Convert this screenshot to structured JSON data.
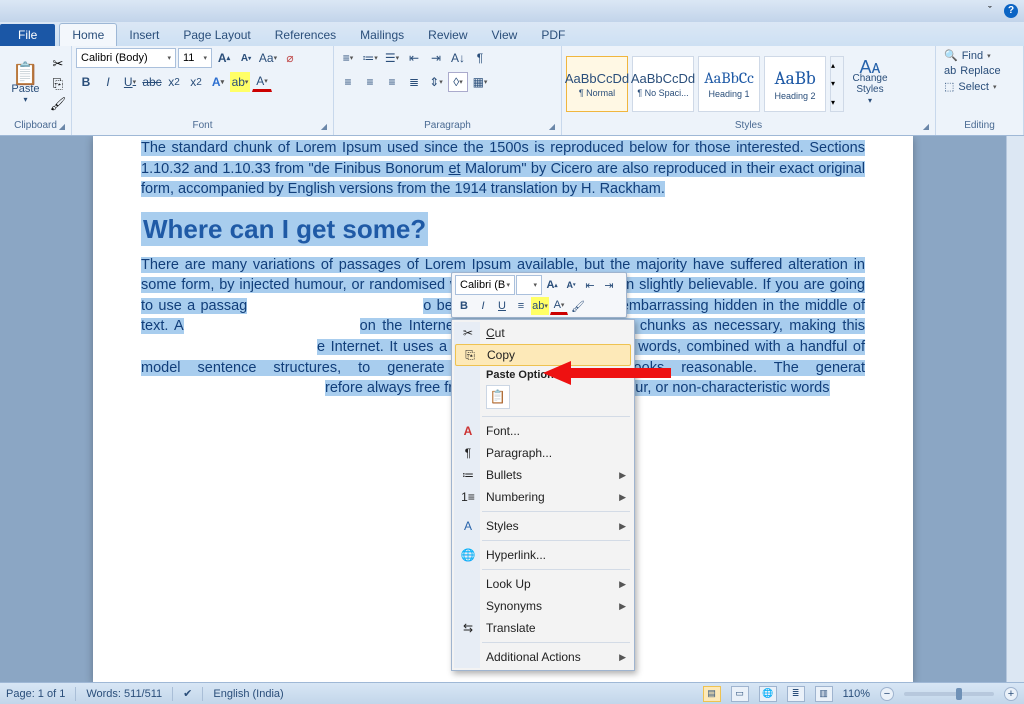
{
  "tabs": {
    "file": "File",
    "home": "Home",
    "insert": "Insert",
    "pageLayout": "Page Layout",
    "references": "References",
    "mailings": "Mailings",
    "review": "Review",
    "view": "View",
    "pdf": "PDF"
  },
  "clipboard": {
    "paste": "Paste",
    "label": "Clipboard"
  },
  "font": {
    "name": "Calibri (Body)",
    "size": "11",
    "label": "Font"
  },
  "paragraph": {
    "label": "Paragraph"
  },
  "styles": {
    "label": "Styles",
    "items": [
      {
        "sample": "AaBbCcDd",
        "name": "¶ Normal"
      },
      {
        "sample": "AaBbCcDd",
        "name": "¶ No Spaci..."
      },
      {
        "sample": "AaBbCc",
        "name": "Heading 1"
      },
      {
        "sample": "AaBb",
        "name": "Heading 2"
      }
    ],
    "change": "Change Styles"
  },
  "editing": {
    "find": "Find",
    "replace": "Replace",
    "select": "Select",
    "label": "Editing"
  },
  "doc": {
    "p1": "The standard chunk of Lorem Ipsum used since the 1500s is reproduced below for those interested. Sections 1.10.32 and 1.10.33 from \"de Finibus Bonorum ",
    "p1u": "et",
    "p1b": " Malorum\" by Cicero are also reproduced in their exact original form, accompanied by English versions from the 1914 translation by H. Rackham.",
    "h1": "Where can I get some?",
    "p2a": "There are many variations of passages of Lorem Ipsum available, but the majority have suffered alteration in some form, by injected humour, or randomised words which don't look even slightly believable. If you are going to use a passag",
    "p2b": "o be sure there isn't anything embarrassing hidden in the middle of text. A",
    "p2c": "on the Internet tend to repeat predefined chunks as necessary, making this ",
    "p2d": "e Internet. It uses a dictionary of over 200 Latin words, combined with a handful of model sentence structures, to generate Lorem Ipsum which looks reasonable. The generat",
    "p2e": "refore always free from repetition, injected humour, or non-characteristic words"
  },
  "minitb": {
    "font": "Calibri (B",
    "size": ""
  },
  "ctx": {
    "cut": "Cut",
    "copy": "Copy",
    "pasteTitle": "Paste Options:",
    "font": "Font...",
    "paragraph": "Paragraph...",
    "bullets": "Bullets",
    "numbering": "Numbering",
    "styles": "Styles",
    "hyperlink": "Hyperlink...",
    "lookup": "Look Up",
    "synonyms": "Synonyms",
    "translate": "Translate",
    "additional": "Additional Actions"
  },
  "status": {
    "page": "Page: 1 of 1",
    "words": "Words: 511/511",
    "lang": "English (India)",
    "zoom": "110%"
  }
}
